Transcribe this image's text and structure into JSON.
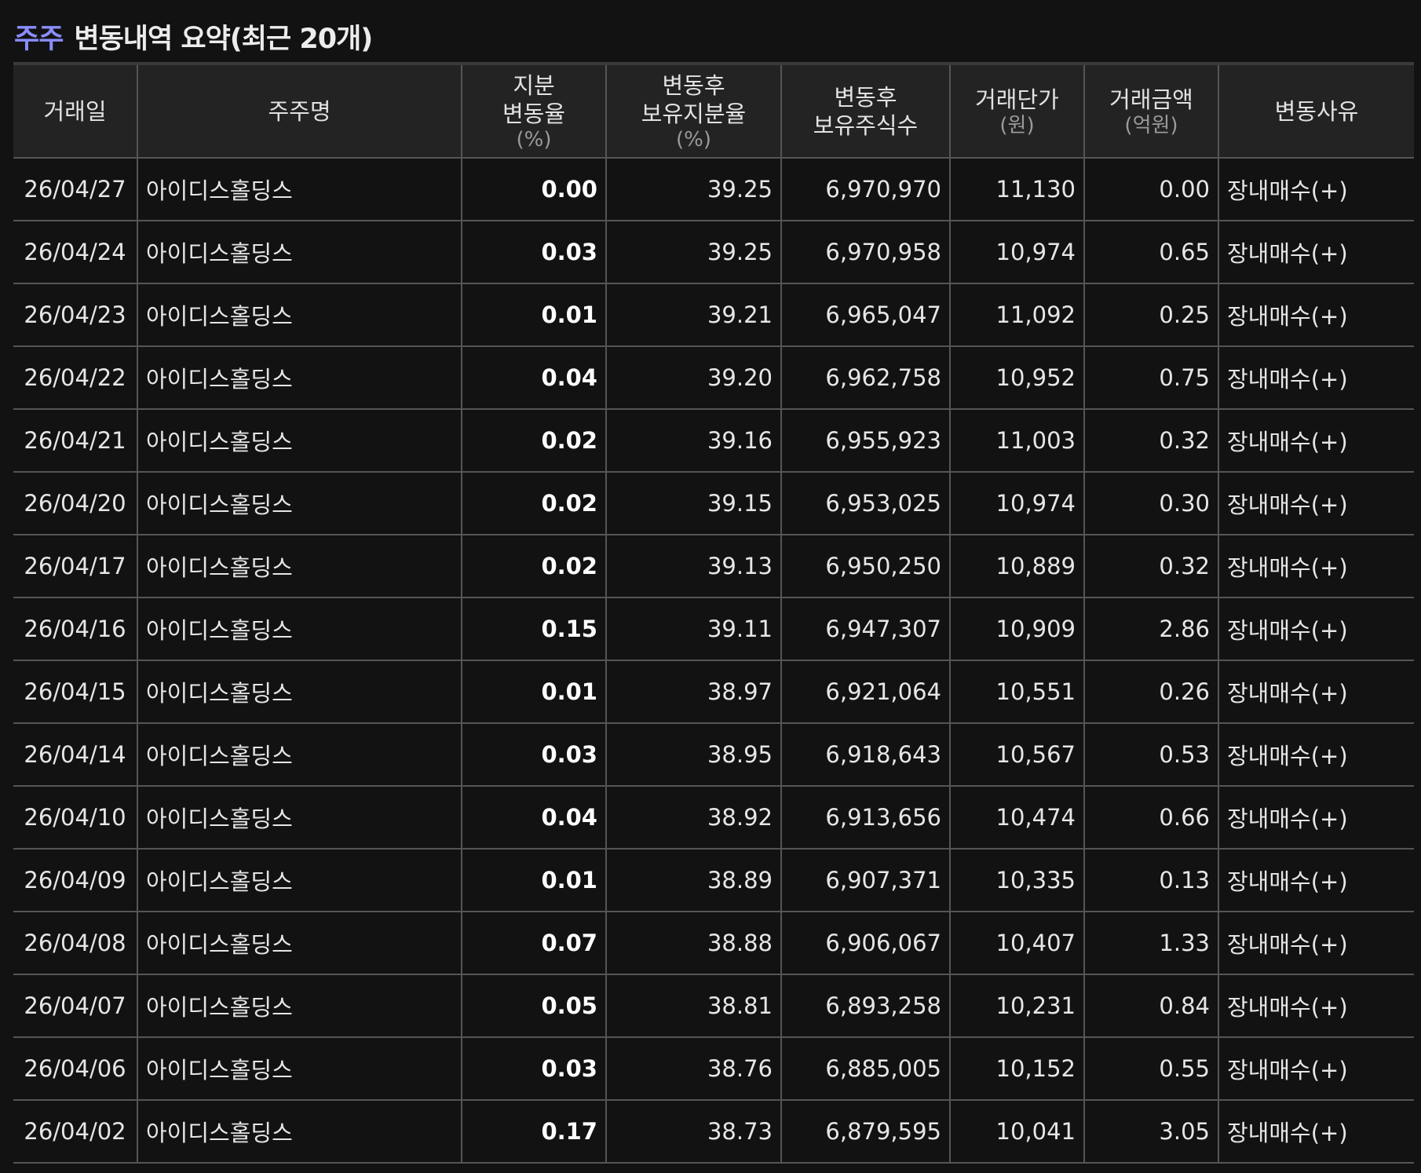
{
  "title": {
    "accent": "주주",
    "main": "변동내역 요약(최근 20개)"
  },
  "columns": [
    {
      "label": "거래일",
      "sub": ""
    },
    {
      "label": "주주명",
      "sub": ""
    },
    {
      "label": "지분\n변동율",
      "sub": "(%)"
    },
    {
      "label": "변동후\n보유지분율",
      "sub": "(%)"
    },
    {
      "label": "변동후\n보유주식수",
      "sub": ""
    },
    {
      "label": "거래단가",
      "sub": "(원)"
    },
    {
      "label": "거래금액",
      "sub": "(억원)"
    },
    {
      "label": "변동사유",
      "sub": ""
    }
  ],
  "rows": [
    {
      "date": "26/04/27",
      "name": "아이디스홀딩스",
      "change": "0.00",
      "ratio": "39.25",
      "shares": "6,970,970",
      "price": "11,130",
      "amount": "0.00",
      "reason": "장내매수(+)"
    },
    {
      "date": "26/04/24",
      "name": "아이디스홀딩스",
      "change": "0.03",
      "ratio": "39.25",
      "shares": "6,970,958",
      "price": "10,974",
      "amount": "0.65",
      "reason": "장내매수(+)"
    },
    {
      "date": "26/04/23",
      "name": "아이디스홀딩스",
      "change": "0.01",
      "ratio": "39.21",
      "shares": "6,965,047",
      "price": "11,092",
      "amount": "0.25",
      "reason": "장내매수(+)"
    },
    {
      "date": "26/04/22",
      "name": "아이디스홀딩스",
      "change": "0.04",
      "ratio": "39.20",
      "shares": "6,962,758",
      "price": "10,952",
      "amount": "0.75",
      "reason": "장내매수(+)"
    },
    {
      "date": "26/04/21",
      "name": "아이디스홀딩스",
      "change": "0.02",
      "ratio": "39.16",
      "shares": "6,955,923",
      "price": "11,003",
      "amount": "0.32",
      "reason": "장내매수(+)"
    },
    {
      "date": "26/04/20",
      "name": "아이디스홀딩스",
      "change": "0.02",
      "ratio": "39.15",
      "shares": "6,953,025",
      "price": "10,974",
      "amount": "0.30",
      "reason": "장내매수(+)"
    },
    {
      "date": "26/04/17",
      "name": "아이디스홀딩스",
      "change": "0.02",
      "ratio": "39.13",
      "shares": "6,950,250",
      "price": "10,889",
      "amount": "0.32",
      "reason": "장내매수(+)"
    },
    {
      "date": "26/04/16",
      "name": "아이디스홀딩스",
      "change": "0.15",
      "ratio": "39.11",
      "shares": "6,947,307",
      "price": "10,909",
      "amount": "2.86",
      "reason": "장내매수(+)"
    },
    {
      "date": "26/04/15",
      "name": "아이디스홀딩스",
      "change": "0.01",
      "ratio": "38.97",
      "shares": "6,921,064",
      "price": "10,551",
      "amount": "0.26",
      "reason": "장내매수(+)"
    },
    {
      "date": "26/04/14",
      "name": "아이디스홀딩스",
      "change": "0.03",
      "ratio": "38.95",
      "shares": "6,918,643",
      "price": "10,567",
      "amount": "0.53",
      "reason": "장내매수(+)"
    },
    {
      "date": "26/04/10",
      "name": "아이디스홀딩스",
      "change": "0.04",
      "ratio": "38.92",
      "shares": "6,913,656",
      "price": "10,474",
      "amount": "0.66",
      "reason": "장내매수(+)"
    },
    {
      "date": "26/04/09",
      "name": "아이디스홀딩스",
      "change": "0.01",
      "ratio": "38.89",
      "shares": "6,907,371",
      "price": "10,335",
      "amount": "0.13",
      "reason": "장내매수(+)"
    },
    {
      "date": "26/04/08",
      "name": "아이디스홀딩스",
      "change": "0.07",
      "ratio": "38.88",
      "shares": "6,906,067",
      "price": "10,407",
      "amount": "1.33",
      "reason": "장내매수(+)"
    },
    {
      "date": "26/04/07",
      "name": "아이디스홀딩스",
      "change": "0.05",
      "ratio": "38.81",
      "shares": "6,893,258",
      "price": "10,231",
      "amount": "0.84",
      "reason": "장내매수(+)"
    },
    {
      "date": "26/04/06",
      "name": "아이디스홀딩스",
      "change": "0.03",
      "ratio": "38.76",
      "shares": "6,885,005",
      "price": "10,152",
      "amount": "0.55",
      "reason": "장내매수(+)"
    },
    {
      "date": "26/04/02",
      "name": "아이디스홀딩스",
      "change": "0.17",
      "ratio": "38.73",
      "shares": "6,879,595",
      "price": "10,041",
      "amount": "3.05",
      "reason": "장내매수(+)"
    }
  ],
  "colors": {
    "background": "#121212",
    "header_bg": "#232323",
    "accent": "#8a8dff",
    "grid": "#555555"
  }
}
